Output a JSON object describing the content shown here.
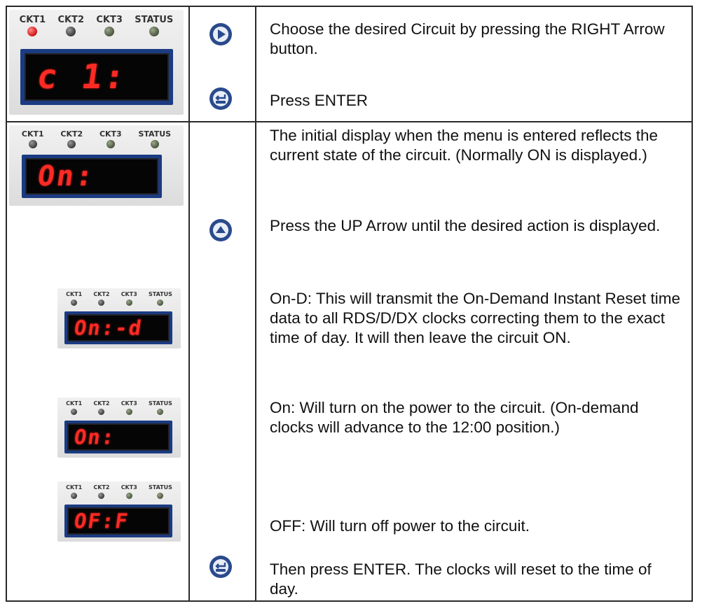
{
  "panel_labels": {
    "ckt1": "CKT1",
    "ckt2": "CKT2",
    "ckt3": "CKT3",
    "status": "STATUS"
  },
  "row1": {
    "display": "c 1:",
    "active_led": "ckt1",
    "instructions": {
      "right_arrow": "Choose the desired Circuit by pressing the RIGHT Arrow button.",
      "enter": "Press ENTER"
    },
    "icons": {
      "right_arrow": "right-arrow-button-icon",
      "enter": "enter-button-icon"
    }
  },
  "row2": {
    "display": "On:",
    "instructions": {
      "initial_display": "The initial display when the menu is entered reflects the current state of the circuit.  (Normally ON is displayed.)",
      "up_arrow": "Press the UP Arrow until the desired action is displayed.",
      "on_d": "On-D: This will transmit the On-Demand Instant Reset time data to all RDS/D/DX clocks correcting them to the exact time of day.  It will then leave the circuit ON.",
      "on": "On:  Will turn on the power to the circuit. (On-demand clocks will advance to the 12:00 position.)",
      "off": "OFF:  Will turn off power to the circuit.",
      "enter": "Then press ENTER.  The clocks will reset to the time of day."
    },
    "option_displays": {
      "on_d": "On:-d",
      "on": "On:",
      "off": "OF:F"
    },
    "icons": {
      "up_arrow": "up-arrow-button-icon",
      "enter": "enter-button-icon"
    }
  },
  "colors": {
    "led_red": "#ff2a24",
    "bezel_blue": "#1b3b82",
    "button_blue": "#2a4a8c"
  }
}
